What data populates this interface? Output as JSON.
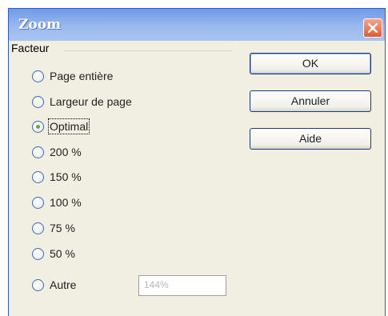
{
  "window": {
    "title": "Zoom"
  },
  "group": {
    "label": "Facteur"
  },
  "options": [
    {
      "label": "Page entière",
      "checked": false
    },
    {
      "label": "Largeur de page",
      "checked": false
    },
    {
      "label": "Optimal",
      "checked": true
    },
    {
      "label": "200 %",
      "checked": false
    },
    {
      "label": "150 %",
      "checked": false
    },
    {
      "label": "100 %",
      "checked": false
    },
    {
      "label": "75 %",
      "checked": false
    },
    {
      "label": "50 %",
      "checked": false
    },
    {
      "label": "Autre",
      "checked": false
    }
  ],
  "custom_value": "144%",
  "buttons": {
    "ok": "OK",
    "cancel": "Annuler",
    "help": "Aide"
  },
  "colors": {
    "titlebar": "#7ea3ea",
    "close": "#e45a2e",
    "accent": "#5fae3a"
  }
}
